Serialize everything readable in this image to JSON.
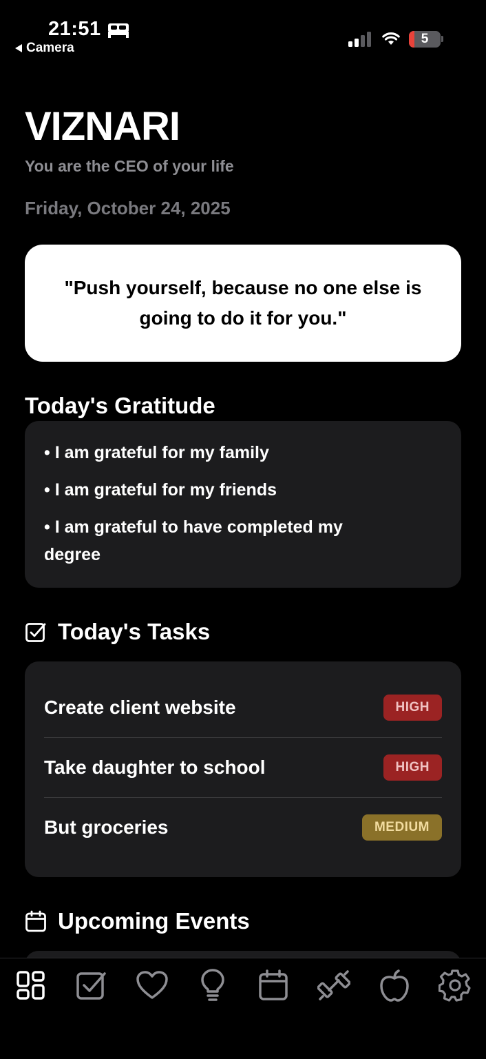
{
  "status_bar": {
    "time": "21:51",
    "back_label": "Camera",
    "battery_level": "5"
  },
  "header": {
    "app_title": "VIZNARI",
    "tagline": "You are the CEO of your life",
    "date": "Friday, October 24, 2025"
  },
  "quote": {
    "text": "\"Push yourself, because no one else is going to do it for you.\""
  },
  "gratitude": {
    "title": "Today's Gratitude",
    "items": [
      "I am grateful for my family",
      "I am grateful for my friends",
      "I am grateful to have completed my degree"
    ]
  },
  "tasks": {
    "title": "Today's Tasks",
    "icon": "checkbox-icon",
    "items": [
      {
        "name": "Create client website",
        "priority": "HIGH",
        "color": "#9b2323"
      },
      {
        "name": "Take daughter to school",
        "priority": "HIGH",
        "color": "#9b2323"
      },
      {
        "name": "But groceries",
        "priority": "MEDIUM",
        "color": "#8a7129"
      }
    ]
  },
  "events": {
    "title": "Upcoming Events",
    "icon": "calendar-icon"
  },
  "tab_bar": {
    "tabs": [
      {
        "icon": "dashboard-icon",
        "active": true
      },
      {
        "icon": "tasks-checkbox-icon",
        "active": false
      },
      {
        "icon": "heart-icon",
        "active": false
      },
      {
        "icon": "lightbulb-icon",
        "active": false
      },
      {
        "icon": "calendar-icon",
        "active": false
      },
      {
        "icon": "dumbbell-icon",
        "active": false
      },
      {
        "icon": "apple-icon",
        "active": false
      },
      {
        "icon": "settings-gear-icon",
        "active": false
      }
    ]
  }
}
